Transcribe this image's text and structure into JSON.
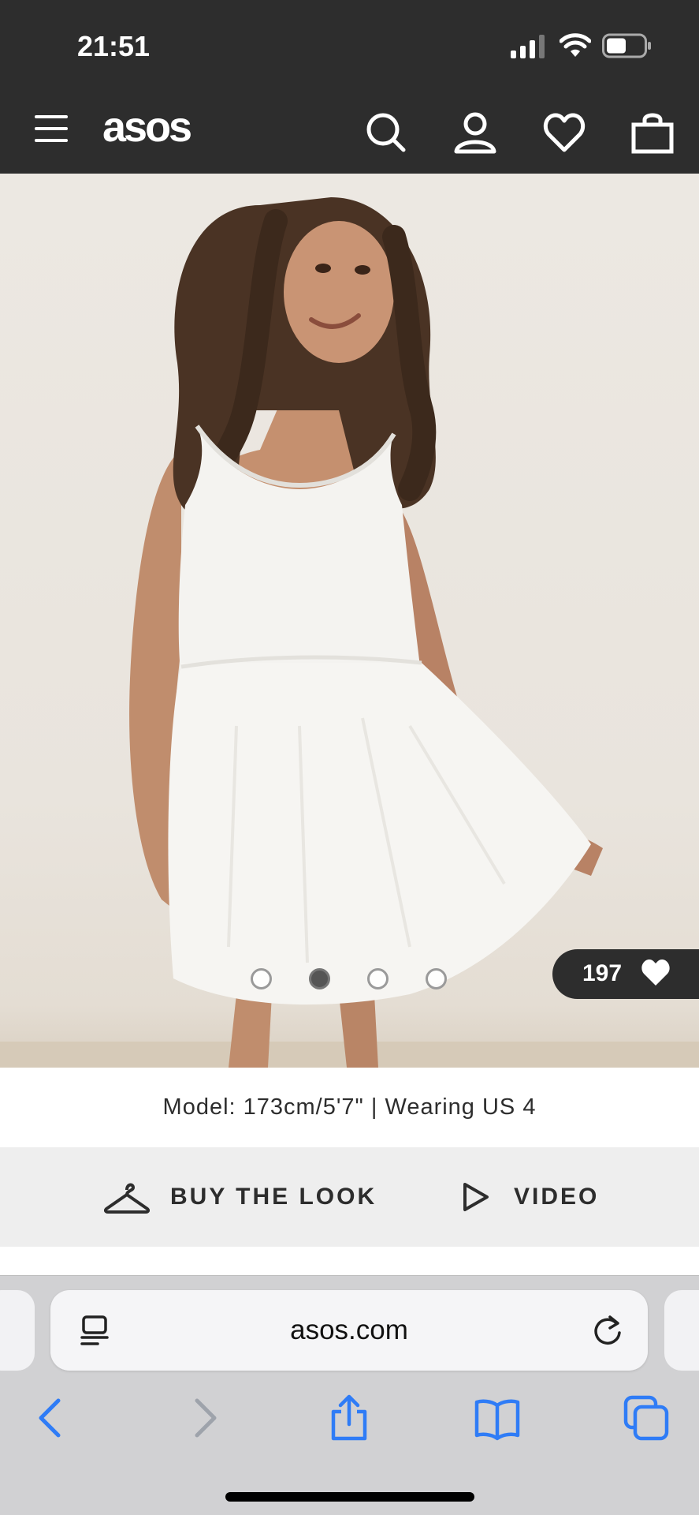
{
  "status_bar": {
    "time": "21:51"
  },
  "header": {
    "logo": "asos"
  },
  "product": {
    "likes_count": "197",
    "active_image_index": 1,
    "image_count": 4,
    "model_info": "Model: 173cm/5'7\" | Wearing US 4"
  },
  "actions": {
    "buy_the_look": "BUY THE LOOK",
    "video": "VIDEO"
  },
  "browser": {
    "url": "asos.com"
  },
  "colors": {
    "header_bg": "#2d2d2d",
    "safari_blue": "#2f7cf6",
    "action_bar_bg": "#eeeeee"
  }
}
